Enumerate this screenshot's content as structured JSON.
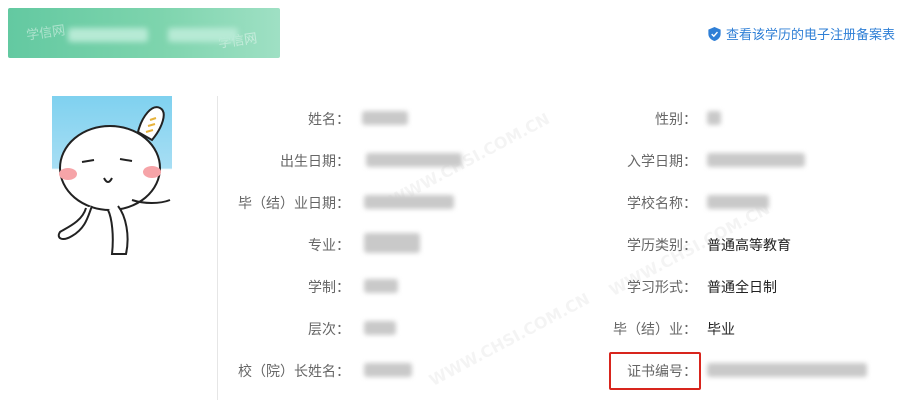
{
  "header": {
    "record_link_label": "查看该学历的电子注册备案表"
  },
  "fields_left": [
    {
      "label": "姓名："
    },
    {
      "label": "出生日期："
    },
    {
      "label": "毕（结）业日期："
    },
    {
      "label": "专业："
    },
    {
      "label": "学制："
    },
    {
      "label": "层次："
    },
    {
      "label": "校（院）长姓名："
    }
  ],
  "fields_right": [
    {
      "label": "性别：",
      "value": ""
    },
    {
      "label": "入学日期：",
      "value": ""
    },
    {
      "label": "学校名称：",
      "value": ""
    },
    {
      "label": "学历类别：",
      "value": "普通高等教育"
    },
    {
      "label": "学习形式：",
      "value": "普通全日制"
    },
    {
      "label": "毕（结）业：",
      "value": "毕业"
    },
    {
      "label": "证书编号：",
      "value": ""
    }
  ],
  "colors": {
    "banner": "#63c9a1",
    "link": "#2f7fd6",
    "highlight": "#d8251d"
  },
  "icons": [
    "shield-check-icon"
  ]
}
